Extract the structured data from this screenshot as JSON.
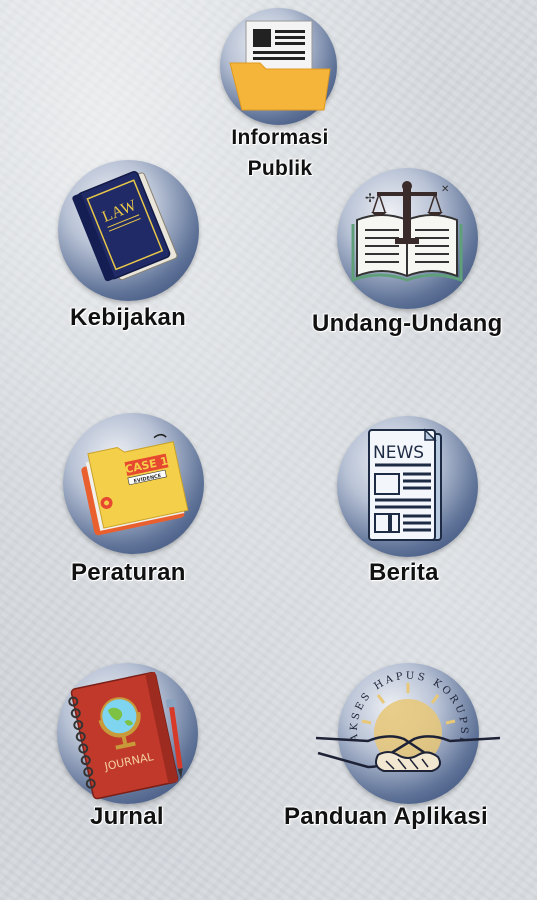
{
  "menu": {
    "items": [
      {
        "id": "informasi-publik",
        "line1": "Informasi",
        "line2": "Publik",
        "icon": "folder-document-icon"
      },
      {
        "id": "kebijakan",
        "label": "Kebijakan",
        "icon": "law-book-icon"
      },
      {
        "id": "undang-undang",
        "label": "Undang-Undang",
        "icon": "scales-of-justice-book-icon"
      },
      {
        "id": "peraturan",
        "label": "Peraturan",
        "icon": "case-file-folder-icon"
      },
      {
        "id": "berita",
        "label": "Berita",
        "icon": "newspaper-icon"
      },
      {
        "id": "jurnal",
        "label": "Jurnal",
        "icon": "journal-globe-icon"
      },
      {
        "id": "panduan-aplikasi",
        "label": "Panduan Aplikasi",
        "icon": "handshake-logo-icon"
      }
    ]
  },
  "icons_text": {
    "law_book": "LAW",
    "case_file": "CASE 1",
    "evidence": "EVIDENCE",
    "news": "NEWS",
    "journal": "JOURNAL",
    "logo_ring": "AKSES HAPUS KORUPSI"
  },
  "colors": {
    "circle_dark": "#2a3f6e",
    "circle_light": "#eef0f4",
    "folder": "#f5b43a",
    "book_navy": "#1f2a66",
    "journal_red": "#c0392b"
  }
}
